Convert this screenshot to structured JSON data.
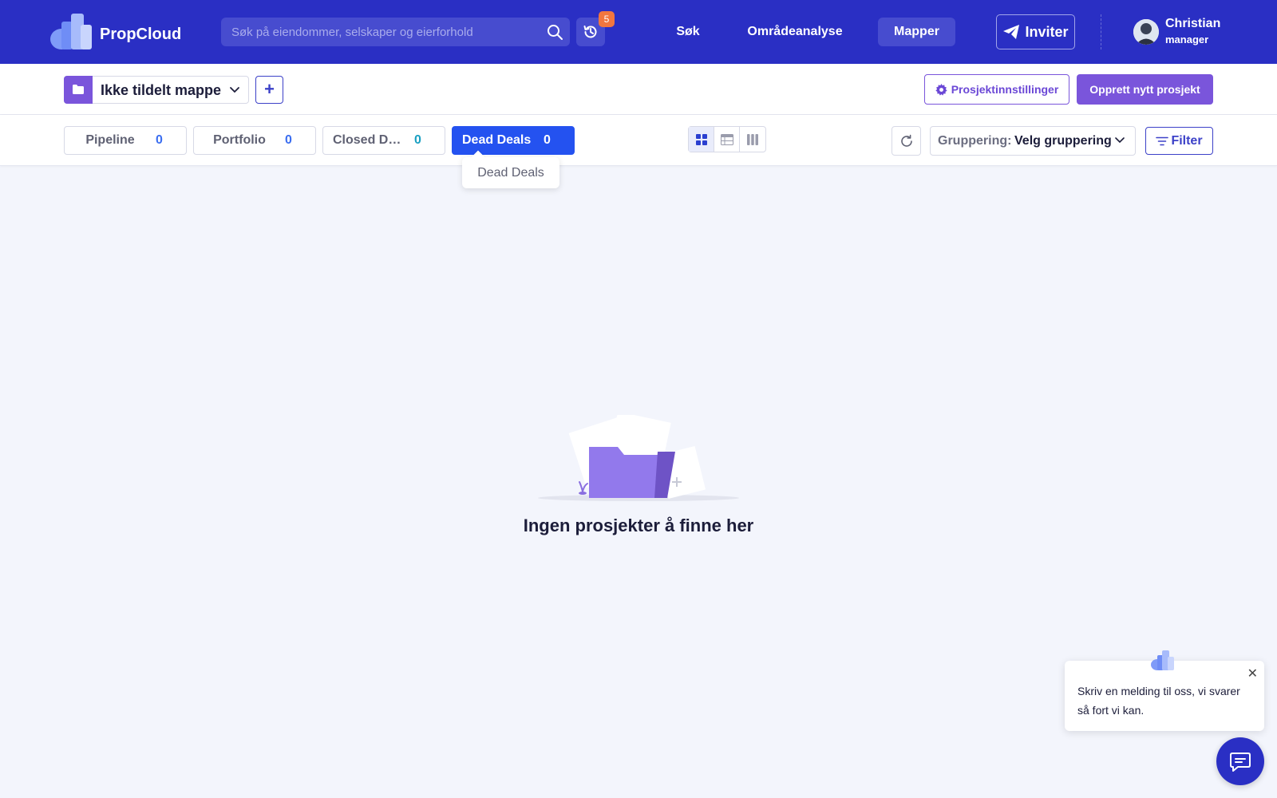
{
  "app": {
    "name": "PropCloud"
  },
  "header": {
    "search_placeholder": "Søk på eiendommer, selskaper og eierforhold",
    "history_badge": "5",
    "nav": [
      {
        "label": "Søk"
      },
      {
        "label": "Områdeanalyse"
      },
      {
        "label": "Mapper"
      }
    ],
    "invite_label": "Inviter",
    "user": {
      "name": "Christian",
      "role": "manager"
    }
  },
  "toolbar": {
    "folder_label": "Ikke tildelt mappe",
    "add_folder_label": "+",
    "project_settings_label": "Prosjektinnstillinger",
    "new_project_label": "Opprett nytt prosjekt"
  },
  "tabs": [
    {
      "label": "Pipeline",
      "count": "0"
    },
    {
      "label": "Portfolio",
      "count": "0"
    },
    {
      "label": "Closed Deals",
      "count": "0"
    },
    {
      "label": "Dead Deals",
      "count": "0",
      "active": true
    }
  ],
  "tooltip": "Dead Deals",
  "grouping": {
    "label": "Gruppering:",
    "value": "Velg gruppering"
  },
  "filter_label": "Filter",
  "empty_state": {
    "text": "Ingen prosjekter å finne her"
  },
  "chat": {
    "message": "Skriv en melding til oss, vi svarer så fort vi kan.",
    "close": "✕"
  },
  "colors": {
    "header_bg": "#2a2fc4",
    "accent_purple": "#7a55db",
    "active_tab": "#2452f0",
    "badge": "#f2763f"
  },
  "icons": [
    "propcloud-logo-icon",
    "search-icon",
    "history-icon",
    "send-icon",
    "folder-icon",
    "chevron-down-icon",
    "gear-icon",
    "grid-view-icon",
    "table-view-icon",
    "board-view-icon",
    "refresh-icon",
    "filter-icon",
    "chat-icon",
    "close-icon"
  ]
}
